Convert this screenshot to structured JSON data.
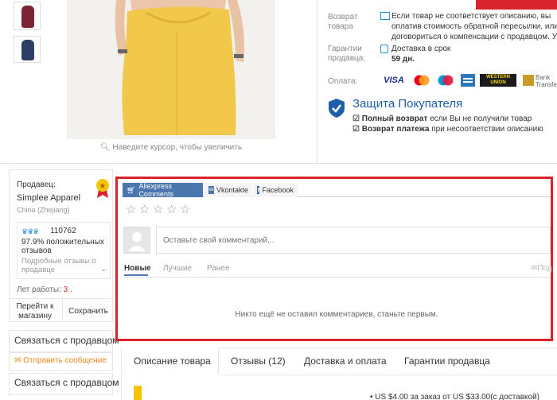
{
  "gallery": {
    "zoom_hint": "Наведите курсор, чтобы увеличить"
  },
  "return_policy": {
    "label": "Возврат товара",
    "lines": [
      "Если товар не соответствует описанию, вы",
      "оплатив стоимость обратной пересылки, или о",
      "договориться о компенсации с продавцом. Узна"
    ]
  },
  "seller_guarantee": {
    "label": "Гарантии продавца:",
    "title": "Доставка в срок",
    "days": "59 дн."
  },
  "payment": {
    "label": "Оплата:",
    "methods": [
      "VISA",
      "MasterCard",
      "Maestro",
      "AmEx",
      "WESTERN UNION",
      "Bank Transfer"
    ],
    "bank_transfer": "Bank Transfer"
  },
  "buyer_protection": {
    "title": "Защита Покупателя",
    "item1_bold": "Полный возврат",
    "item1_rest": " если Вы не получили товар",
    "item2_bold": "Возврат платежа",
    "item2_rest": " при несоответствии описанию"
  },
  "seller": {
    "label": "Продавец:",
    "name": "Simplee Apparel",
    "location": "China (Zhejiang)",
    "score": "110762",
    "positive_pct": "97.9%",
    "positive_text": "положительных отзывов",
    "detailed_reviews": "Подробные отзывы о продавце",
    "years_label": "Лет работы:",
    "years": "3",
    "goto_store": "Перейти к магазину",
    "save": "Сохранить"
  },
  "comments": {
    "tabs": [
      "Aliexpress Comments",
      "Vkontakte",
      "Facebook"
    ],
    "placeholder": "Оставьте свой комментарий...",
    "sort": [
      "Новые",
      "Лучшие",
      "Ранее"
    ],
    "subscribe": "Под",
    "empty": "Никто ещё не оставил комментариев, станьте первым."
  },
  "contact": {
    "title1": "Связаться с продавцом",
    "send_message": "Отправить сообщение",
    "title2": "Связаться с продавцом"
  },
  "product_tabs": {
    "items": [
      "Описание товара",
      "Отзывы (12)",
      "Доставка и оплата",
      "Гарантии продавца"
    ],
    "bullet": "US $4.00 за заказ от US $33.00(с доставкой)"
  },
  "colors": {
    "accent_red": "#d9232d",
    "link_blue": "#1f8fd1",
    "protection_blue": "#1d5fa8",
    "tab_blue": "#4a77ae",
    "star_yellow": "#f6c400",
    "dress_yellow": "#f2c84b",
    "orange": "#ef8a1e"
  }
}
